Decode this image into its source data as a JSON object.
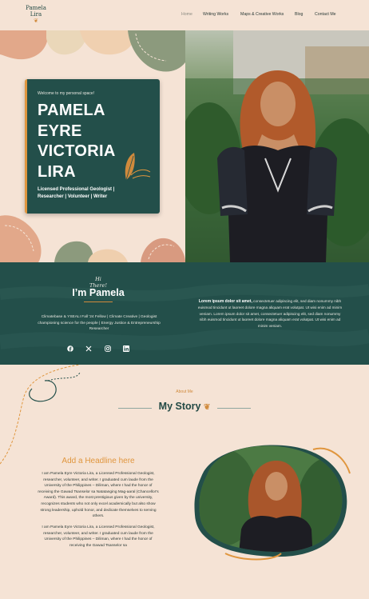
{
  "logo": {
    "line1": "Pamela",
    "line2": "Lira",
    "icon": "leaf-icon"
  },
  "nav": {
    "items": [
      {
        "label": "Home",
        "active": true
      },
      {
        "label": "Writing Works",
        "active": false
      },
      {
        "label": "Maps & Creative Works",
        "active": false
      },
      {
        "label": "Blog",
        "active": false
      },
      {
        "label": "Contact Me",
        "active": false
      }
    ]
  },
  "hero": {
    "welcome": "Welcome to my personal space!",
    "name": "PAMELA EYRE VICTORIA LIRA",
    "tagline": "Licensed Professional Geologist | Researcher | Volunteer | Writer"
  },
  "intro": {
    "greeting": "Hi There!",
    "heading": "I’m Pamela",
    "roles": "Climatebase & YSEALI Fall '24 Fellow | Climate Creative | Geologist championing science for the people | Energy Justice & Entrepreneurship Researcher",
    "lorem_bold": "Lorem ipsum dolor sit amet,",
    "lorem_rest": " consectetuer adipiscing elit, sed diam nonummy nibh euismod tincidunt ut laoreet dolore magna aliquam erat volutpat. Ut wisi enim ad minim veniam. Lorem ipsum dolor sit amet, consectetuer adipiscing elit, sed diam nonummy nibh euismod tincidunt ut laoreet dolore magna aliquam erat volutpat. Ut wisi enim ad minim veniam."
  },
  "socials": [
    {
      "icon": "facebook-icon",
      "glyph": "f"
    },
    {
      "icon": "x-twitter-icon",
      "glyph": "𝕏"
    },
    {
      "icon": "instagram-icon",
      "glyph": "◎"
    },
    {
      "icon": "linkedin-icon",
      "glyph": "in"
    }
  ],
  "story": {
    "label": "About Me",
    "title": "My Story",
    "headline": "Add a Headline here",
    "paragraph1": "I am Pamela Eyre Victoria Lira, a Licensed Professional Geologist, researcher, volunteer, and writer. I graduated cum laude from the University of the Philippines – Diliman, where I had the honor of receiving the Gawad Tsanselor sa Natatanging Mag-aaral (Chancellor's Award). This award, the most prestigious given by the university, recognizes students who not only excel academically but also show strong leadership, uphold honor, and dedicate themselves to serving others.",
    "paragraph2": "I am Pamela Eyre Victoria Lira, a Licensed Professional Geologist, researcher, volunteer, and writer. I graduated cum laude from the University of the Philippines – Diliman, where I had the honor of receiving the Gawad Tsanselor sa"
  },
  "colors": {
    "background": "#f5e3d5",
    "teal": "#234f4a",
    "accent": "#e0963e"
  }
}
